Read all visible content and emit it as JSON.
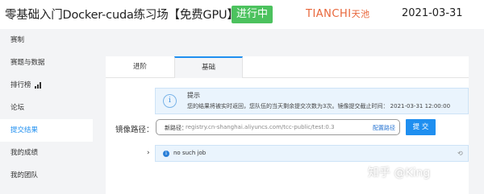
{
  "header": {
    "title": "零基础入门Docker-cuda练习场【免费GPU】",
    "status": "进行中",
    "logo_text": "TIANCHI",
    "logo_cn": "天池",
    "date": "2021-03-31"
  },
  "sidebar": {
    "items": [
      {
        "label": "赛制",
        "active": false
      },
      {
        "label": "赛题与数据",
        "active": false
      },
      {
        "label": "排行榜",
        "active": false,
        "icon": "bar-chart-icon"
      },
      {
        "label": "论坛",
        "active": false
      },
      {
        "label": "提交结果",
        "active": true
      },
      {
        "label": "我的成绩",
        "active": false
      },
      {
        "label": "我的团队",
        "active": false
      }
    ]
  },
  "tabs": [
    {
      "label": "进阶",
      "active": false
    },
    {
      "label": "基础",
      "active": true
    }
  ],
  "notice": {
    "title": "提示",
    "text": "您的结果将被实时返回，您队伍的当天剩余提交次数为3次。镜像提交截止时间： 2021-03-31 12:00:00"
  },
  "mirror": {
    "label": "镜像路径：",
    "prefix": "新路径：",
    "value": "registry.cn-shanghai.aliyuncs.com/tcc-public/test:0.3",
    "config_link": "配置路径",
    "submit_label": "提 交"
  },
  "job": {
    "text": "no such job"
  },
  "watermark": "知乎 @King",
  "colors": {
    "accent": "#1f8ff0",
    "status_green": "#4cc25e",
    "logo_orange": "#e8663a"
  }
}
